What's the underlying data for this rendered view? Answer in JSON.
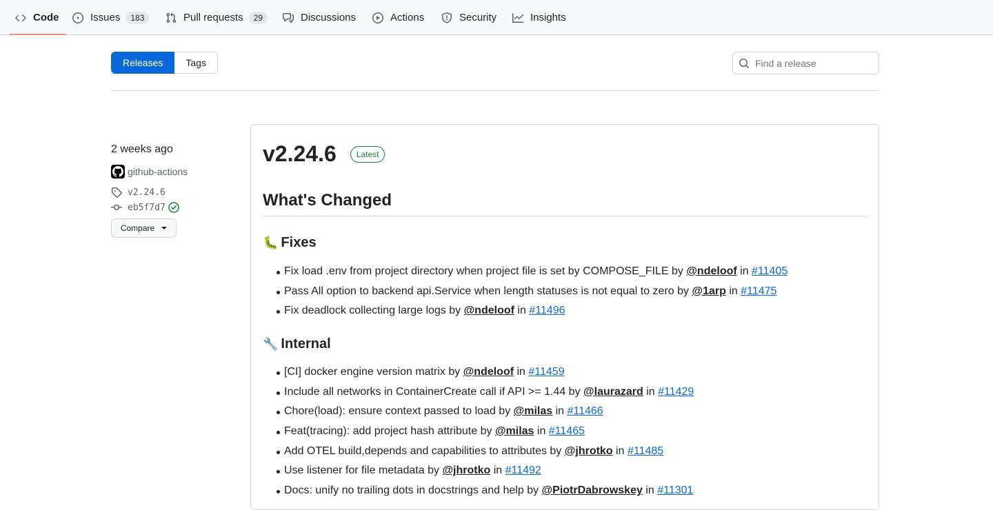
{
  "nav": {
    "items": [
      {
        "label": "Code",
        "icon": "code-icon",
        "selected": true
      },
      {
        "label": "Issues",
        "icon": "issue-opened-icon",
        "count": "183"
      },
      {
        "label": "Pull requests",
        "icon": "git-pull-request-icon",
        "count": "29"
      },
      {
        "label": "Discussions",
        "icon": "comment-discussion-icon"
      },
      {
        "label": "Actions",
        "icon": "play-icon"
      },
      {
        "label": "Security",
        "icon": "shield-icon"
      },
      {
        "label": "Insights",
        "icon": "graph-icon"
      }
    ]
  },
  "subnav": {
    "releases": "Releases",
    "tags": "Tags"
  },
  "search": {
    "placeholder": "Find a release"
  },
  "meta": {
    "date": "2 weeks ago",
    "author": "github-actions",
    "tag": "v2.24.6",
    "commit": "eb5f7d7",
    "compare": "Compare"
  },
  "release": {
    "version": "v2.24.6",
    "badge": "Latest",
    "whats_changed": "What's Changed",
    "fixes": {
      "emoji": "🐛",
      "title": "Fixes",
      "items": [
        {
          "text": "Fix load .env from project directory when project file is set by COMPOSE_FILE by ",
          "user": "@ndeloof",
          "in": " in ",
          "pr": "#11405"
        },
        {
          "text": "Pass All option to backend api.Service when length statuses is not equal to zero by ",
          "user": "@1arp",
          "in": " in ",
          "pr": "#11475"
        },
        {
          "text": "Fix deadlock collecting large logs by ",
          "user": "@ndeloof",
          "in": " in ",
          "pr": "#11496"
        }
      ]
    },
    "internal": {
      "emoji": "🔧",
      "title": "Internal",
      "items": [
        {
          "text": "[CI] docker engine version matrix by ",
          "user": "@ndeloof",
          "in": " in ",
          "pr": "#11459"
        },
        {
          "text": "Include all networks in ContainerCreate call if API >= 1.44 by ",
          "user": "@laurazard",
          "in": " in ",
          "pr": "#11429"
        },
        {
          "text": "Chore(load): ensure context passed to load by ",
          "user": "@milas",
          "in": " in ",
          "pr": "#11466"
        },
        {
          "text": "Feat(tracing): add project hash attribute by ",
          "user": "@milas",
          "in": " in ",
          "pr": "#11465"
        },
        {
          "text": "Add OTEL build,depends and capabilities to attributes by ",
          "user": "@jhrotko",
          "in": " in ",
          "pr": "#11485"
        },
        {
          "text": "Use listener for file metadata by ",
          "user": "@jhrotko",
          "in": " in ",
          "pr": "#11492"
        },
        {
          "text": "Docs: unify no trailing dots in docstrings and help by ",
          "user": "@PiotrDabrowskey",
          "in": " in ",
          "pr": "#11301"
        }
      ]
    }
  }
}
